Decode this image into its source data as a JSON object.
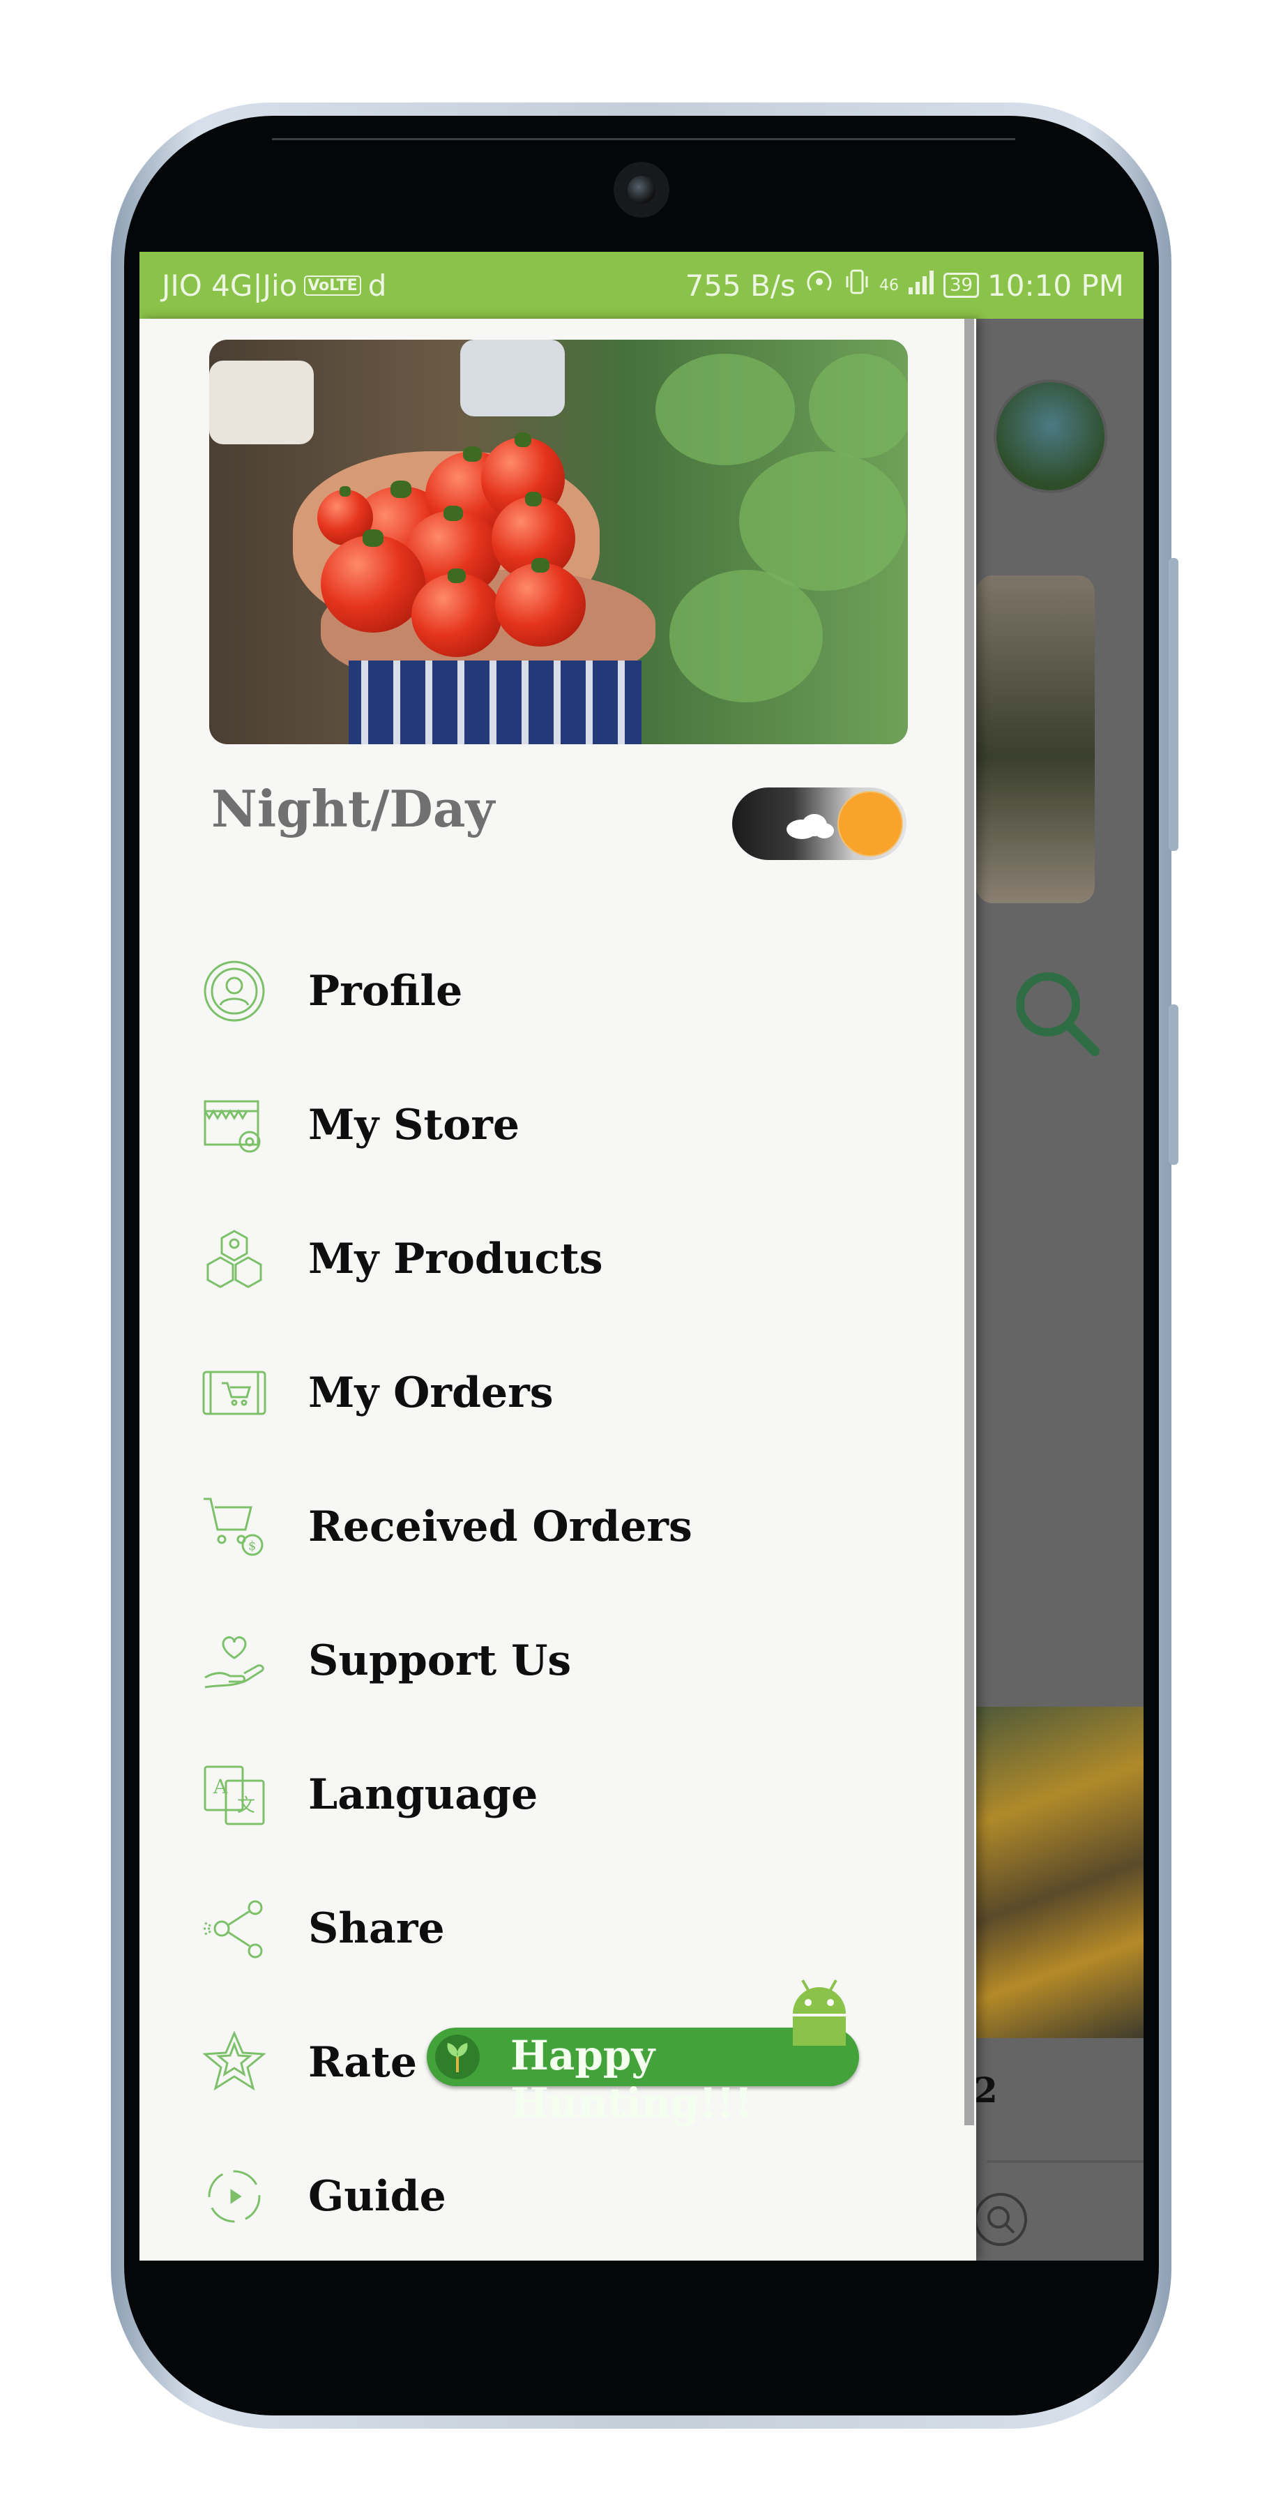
{
  "status_bar": {
    "carrier": "JIO 4G|Jio",
    "volte": "VoLTE",
    "extra": "d",
    "speed": "755 B/s",
    "network": "46",
    "battery": "39",
    "time": "10:10 PM"
  },
  "drawer": {
    "night_day_label": "Night/Day",
    "menu": [
      {
        "label": "Profile",
        "icon": "profile-icon"
      },
      {
        "label": "My Store",
        "icon": "store-icon"
      },
      {
        "label": "My Products",
        "icon": "products-icon"
      },
      {
        "label": "My Orders",
        "icon": "orders-icon"
      },
      {
        "label": "Received Orders",
        "icon": "received-orders-icon"
      },
      {
        "label": "Support Us",
        "icon": "support-icon"
      },
      {
        "label": "Language",
        "icon": "language-icon"
      },
      {
        "label": "Share",
        "icon": "share-icon"
      },
      {
        "label": "Rate us",
        "icon": "star-icon"
      },
      {
        "label": "Guide",
        "icon": "guide-icon"
      }
    ]
  },
  "toast": {
    "text": "Happy Hunting!!!"
  },
  "background": {
    "partial_text": "2"
  },
  "colors": {
    "accent": "#8bc34a",
    "icon_green": "#7cc06a",
    "toast": "#43a33a",
    "toggle_knob": "#f8a32b"
  }
}
